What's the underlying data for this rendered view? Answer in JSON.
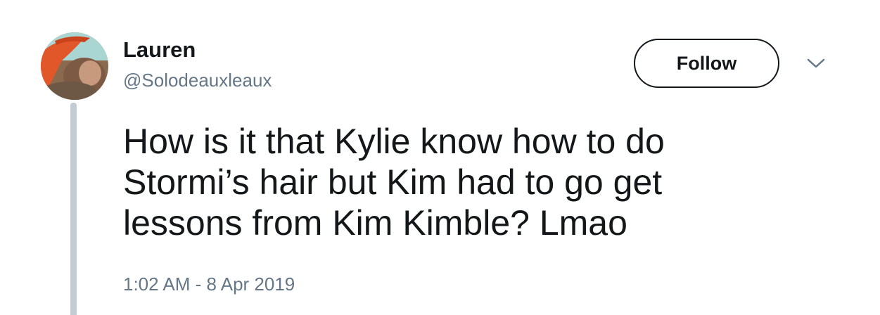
{
  "user": {
    "display_name": "Lauren",
    "handle": "@Solodeauxleaux"
  },
  "follow_button": {
    "label": "Follow"
  },
  "menu": {
    "icon": "chevron-down-icon"
  },
  "tweet": {
    "text": "How is it that Kylie know how to do\nStormi’s hair but Kim had to go get\nlessons from Kim Kimble? Lmao",
    "timestamp": "1:02 AM - 8 Apr 2019"
  },
  "colors": {
    "primary_text": "#14171a",
    "secondary_text": "#657786",
    "thread_line": "#c4ccd3",
    "avatar_hat": "#e2572a"
  }
}
